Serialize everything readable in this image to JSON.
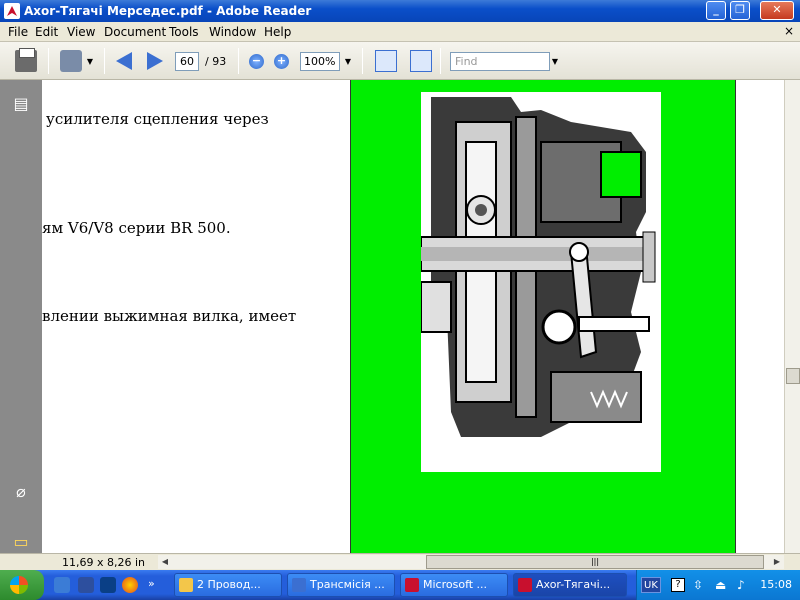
{
  "window": {
    "title": "Axor-Тягачі Мерседес.pdf - Adobe Reader"
  },
  "menu": {
    "items": [
      "File",
      "Edit",
      "View",
      "Document",
      "Tools",
      "Window",
      "Help"
    ],
    "close_glyph": "×"
  },
  "toolbar": {
    "page_current": "60",
    "page_total": "/ 93",
    "zoom": "100%",
    "find_placeholder": "Find"
  },
  "document": {
    "lines": [
      "усилителя сцепления через",
      "ям V6/V8 серии BR 500.",
      "влении выжимная вилка, имеет"
    ],
    "panel_color": "#00ee00"
  },
  "statusbar": {
    "page_size": "11,69 x 8,26 in"
  },
  "taskbar": {
    "tasks": [
      {
        "label": "2 Провод...",
        "color": "#f3c64a"
      },
      {
        "label": "Трансмісія ...",
        "color": "#3b6fd1"
      },
      {
        "label": "Microsoft ...",
        "color": "#c8102e"
      },
      {
        "label": "Axor-Тягачі...",
        "color": "#c8102e"
      }
    ],
    "language": "UK",
    "clock": "15:08"
  },
  "icons": {
    "nav": [
      "pages-icon",
      "paperclip-icon",
      "comments-icon"
    ],
    "toolbar": [
      "printer-icon",
      "email-icon",
      "prev-page-icon",
      "next-page-icon",
      "zoom-out-icon",
      "zoom-in-icon",
      "fit-width-icon",
      "fit-page-icon"
    ]
  }
}
